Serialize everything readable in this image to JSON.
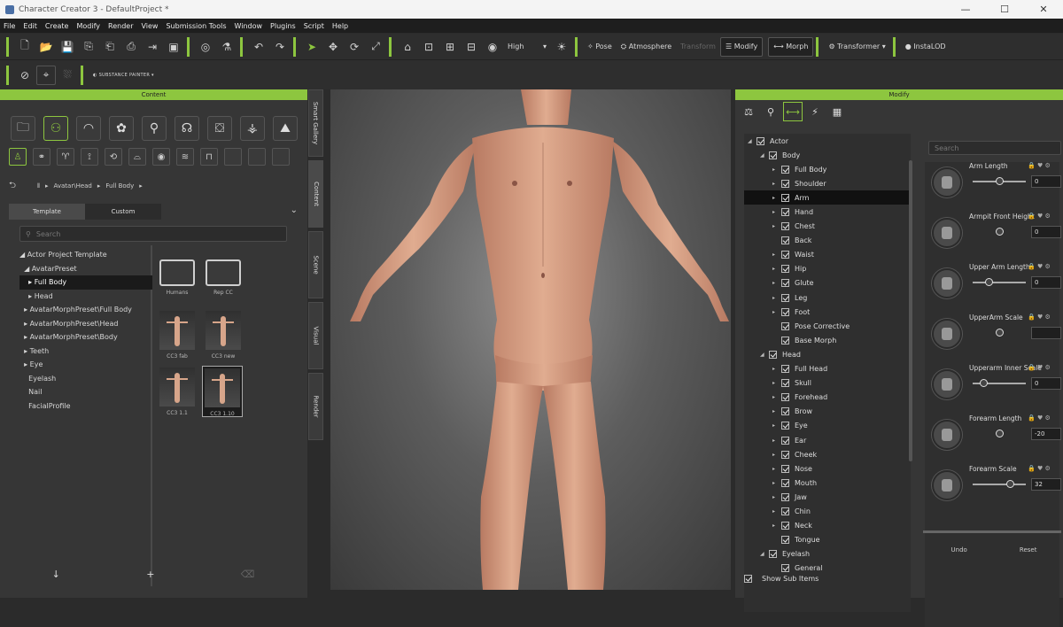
{
  "window": {
    "title": "Character Creator 3 - DefaultProject *"
  },
  "menu": [
    "File",
    "Edit",
    "Create",
    "Modify",
    "Render",
    "View",
    "Submission Tools",
    "Window",
    "Plugins",
    "Script",
    "Help"
  ],
  "toolbar": {
    "quality": "High",
    "pose_label": "Pose",
    "atmosphere_label": "Atmosphere",
    "disabled_label": "Transform",
    "modify_label": "Modify",
    "morph_label": "Morph",
    "transformer_label": "Transformer",
    "insta_label": "InstaLOD",
    "substance_label": "SUBSTANCE PAINTER"
  },
  "content_panel": {
    "header": "Content",
    "breadcrumb": [
      "Avatar\\Head",
      "Full Body"
    ],
    "tabs": [
      "Template",
      "Custom"
    ],
    "search_placeholder": "Search",
    "tree": [
      {
        "label": "Actor Project Template",
        "prefix": "◢ "
      },
      {
        "label": "AvatarPreset",
        "prefix": "  ◢ "
      },
      {
        "label": "Full Body",
        "prefix": "    ▸ ",
        "selected": true
      },
      {
        "label": "Head",
        "prefix": "    ▸ "
      },
      {
        "label": "AvatarMorphPreset\\Full Body",
        "prefix": "  ▸ "
      },
      {
        "label": "AvatarMorphPreset\\Head",
        "prefix": "  ▸ "
      },
      {
        "label": "AvatarMorphPreset\\Body",
        "prefix": "  ▸ "
      },
      {
        "label": "Teeth",
        "prefix": "  ▸ "
      },
      {
        "label": "Eye",
        "prefix": "  ▸ "
      },
      {
        "label": "Eyelash",
        "prefix": "    "
      },
      {
        "label": "Nail",
        "prefix": "    "
      },
      {
        "label": "FacialProfile",
        "prefix": "    "
      }
    ],
    "thumbnails": [
      {
        "caption": "Humans"
      },
      {
        "caption": "Rep CC"
      },
      {
        "caption": "CC3 fab"
      },
      {
        "caption": "CC3 new"
      },
      {
        "caption": "CC3 1.1"
      },
      {
        "caption": "CC3 1.10"
      }
    ]
  },
  "side_tabs": [
    "Smart Gallery",
    "Content",
    "Scene",
    "Visual",
    "Render"
  ],
  "modify_panel": {
    "header": "Modify",
    "search_placeholder": "Search",
    "tree": [
      {
        "label": "Actor",
        "depth": 0,
        "arrow": "◢"
      },
      {
        "label": "Body",
        "depth": 1,
        "arrow": "◢"
      },
      {
        "label": "Full Body",
        "depth": 2,
        "arrow": "▸"
      },
      {
        "label": "Shoulder",
        "depth": 2,
        "arrow": "▸"
      },
      {
        "label": "Arm",
        "depth": 2,
        "arrow": "▸",
        "selected": true
      },
      {
        "label": "Hand",
        "depth": 2,
        "arrow": "▸"
      },
      {
        "label": "Chest",
        "depth": 2,
        "arrow": "▸"
      },
      {
        "label": "Back",
        "depth": 2,
        "arrow": ""
      },
      {
        "label": "Waist",
        "depth": 2,
        "arrow": "▸"
      },
      {
        "label": "Hip",
        "depth": 2,
        "arrow": "▸"
      },
      {
        "label": "Glute",
        "depth": 2,
        "arrow": "▸"
      },
      {
        "label": "Leg",
        "depth": 2,
        "arrow": "▸"
      },
      {
        "label": "Foot",
        "depth": 2,
        "arrow": "▸"
      },
      {
        "label": "Pose Corrective",
        "depth": 2,
        "arrow": ""
      },
      {
        "label": "Base Morph",
        "depth": 2,
        "arrow": ""
      },
      {
        "label": "Head",
        "depth": 1,
        "arrow": "◢"
      },
      {
        "label": "Full Head",
        "depth": 2,
        "arrow": "▸"
      },
      {
        "label": "Skull",
        "depth": 2,
        "arrow": "▸"
      },
      {
        "label": "Forehead",
        "depth": 2,
        "arrow": "▸"
      },
      {
        "label": "Brow",
        "depth": 2,
        "arrow": "▸"
      },
      {
        "label": "Eye",
        "depth": 2,
        "arrow": "▸"
      },
      {
        "label": "Ear",
        "depth": 2,
        "arrow": "▸"
      },
      {
        "label": "Cheek",
        "depth": 2,
        "arrow": "▸"
      },
      {
        "label": "Nose",
        "depth": 2,
        "arrow": "▸"
      },
      {
        "label": "Mouth",
        "depth": 2,
        "arrow": "▸"
      },
      {
        "label": "Jaw",
        "depth": 2,
        "arrow": "▸"
      },
      {
        "label": "Chin",
        "depth": 2,
        "arrow": "▸"
      },
      {
        "label": "Neck",
        "depth": 2,
        "arrow": "▸"
      },
      {
        "label": "Tongue",
        "depth": 2,
        "arrow": ""
      },
      {
        "label": "Eyelash",
        "depth": 1,
        "arrow": "◢"
      },
      {
        "label": "General",
        "depth": 2,
        "arrow": ""
      }
    ],
    "sliders": [
      {
        "label": "Arm Length",
        "value": "0",
        "pos": 0.5,
        "has_track": true
      },
      {
        "label": "Armpit Front Height",
        "value": "0",
        "pos": 0.5,
        "has_track": false
      },
      {
        "label": "Upper Arm Length",
        "value": "0",
        "pos": 0.3,
        "has_track": true
      },
      {
        "label": "UpperArm Scale",
        "value": "",
        "pos": 0.5,
        "has_track": false
      },
      {
        "label": "Upperarm Inner Scale",
        "value": "0",
        "pos": 0.2,
        "has_track": true
      },
      {
        "label": "Forearm Length",
        "value": "-20",
        "pos": 0.5,
        "has_track": false
      },
      {
        "label": "Forearm Scale",
        "value": "32",
        "pos": 0.7,
        "has_track": true
      }
    ],
    "slider_icons": "🔒 ♥ ⚙",
    "footer_left": "Undo",
    "footer_right": "Reset",
    "show_sub_items": "Show Sub Items"
  }
}
